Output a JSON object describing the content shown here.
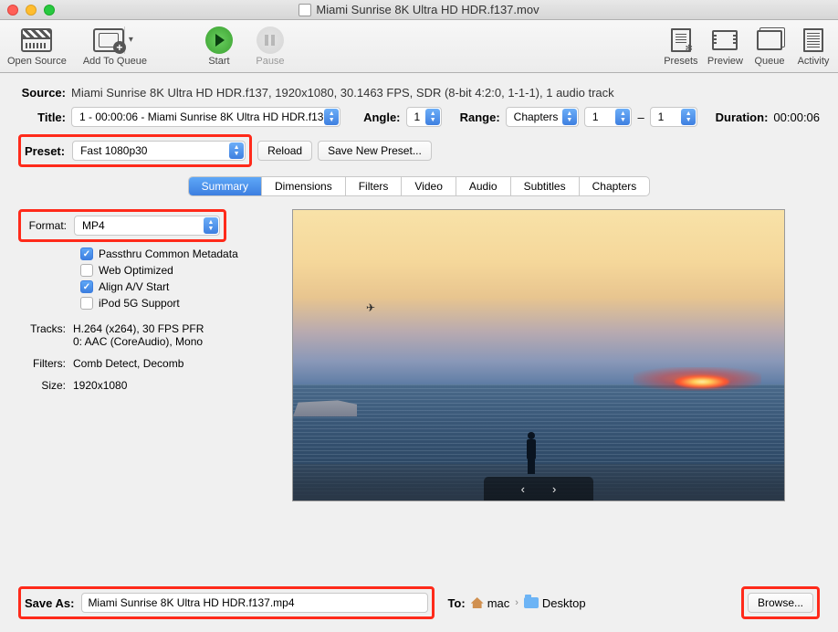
{
  "window": {
    "title": "Miami Sunrise 8K Ultra HD HDR.f137.mov"
  },
  "toolbar": {
    "open_source": "Open Source",
    "add_to_queue": "Add To Queue",
    "start": "Start",
    "pause": "Pause",
    "presets": "Presets",
    "preview": "Preview",
    "queue": "Queue",
    "activity": "Activity"
  },
  "source": {
    "label": "Source:",
    "value": "Miami Sunrise 8K Ultra HD HDR.f137, 1920x1080, 30.1463 FPS, SDR (8-bit 4:2:0, 1-1-1), 1 audio track"
  },
  "title_row": {
    "label": "Title:",
    "value": "1 - 00:00:06 - Miami Sunrise 8K Ultra HD HDR.f137",
    "angle_label": "Angle:",
    "angle_value": "1",
    "range_label": "Range:",
    "range_type": "Chapters",
    "range_from": "1",
    "range_sep": "–",
    "range_to": "1",
    "duration_label": "Duration:",
    "duration_value": "00:00:06"
  },
  "preset_row": {
    "label": "Preset:",
    "value": "Fast 1080p30",
    "reload": "Reload",
    "save_new": "Save New Preset..."
  },
  "tabs": [
    "Summary",
    "Dimensions",
    "Filters",
    "Video",
    "Audio",
    "Subtitles",
    "Chapters"
  ],
  "active_tab": 0,
  "summary": {
    "format_label": "Format:",
    "format_value": "MP4",
    "checks": {
      "passthru": "Passthru Common Metadata",
      "web": "Web Optimized",
      "align": "Align A/V Start",
      "ipod": "iPod 5G Support"
    },
    "checks_state": {
      "passthru": true,
      "web": false,
      "align": true,
      "ipod": false
    },
    "tracks_label": "Tracks:",
    "tracks_line1": "H.264 (x264), 30 FPS PFR",
    "tracks_line2": "0: AAC (CoreAudio), Mono",
    "filters_label": "Filters:",
    "filters_value": "Comb Detect, Decomb",
    "size_label": "Size:",
    "size_value": "1920x1080"
  },
  "footer": {
    "save_as_label": "Save As:",
    "save_as_value": "Miami Sunrise 8K Ultra HD HDR.f137.mp4",
    "to_label": "To:",
    "path_home": "mac",
    "path_folder": "Desktop",
    "browse": "Browse..."
  }
}
